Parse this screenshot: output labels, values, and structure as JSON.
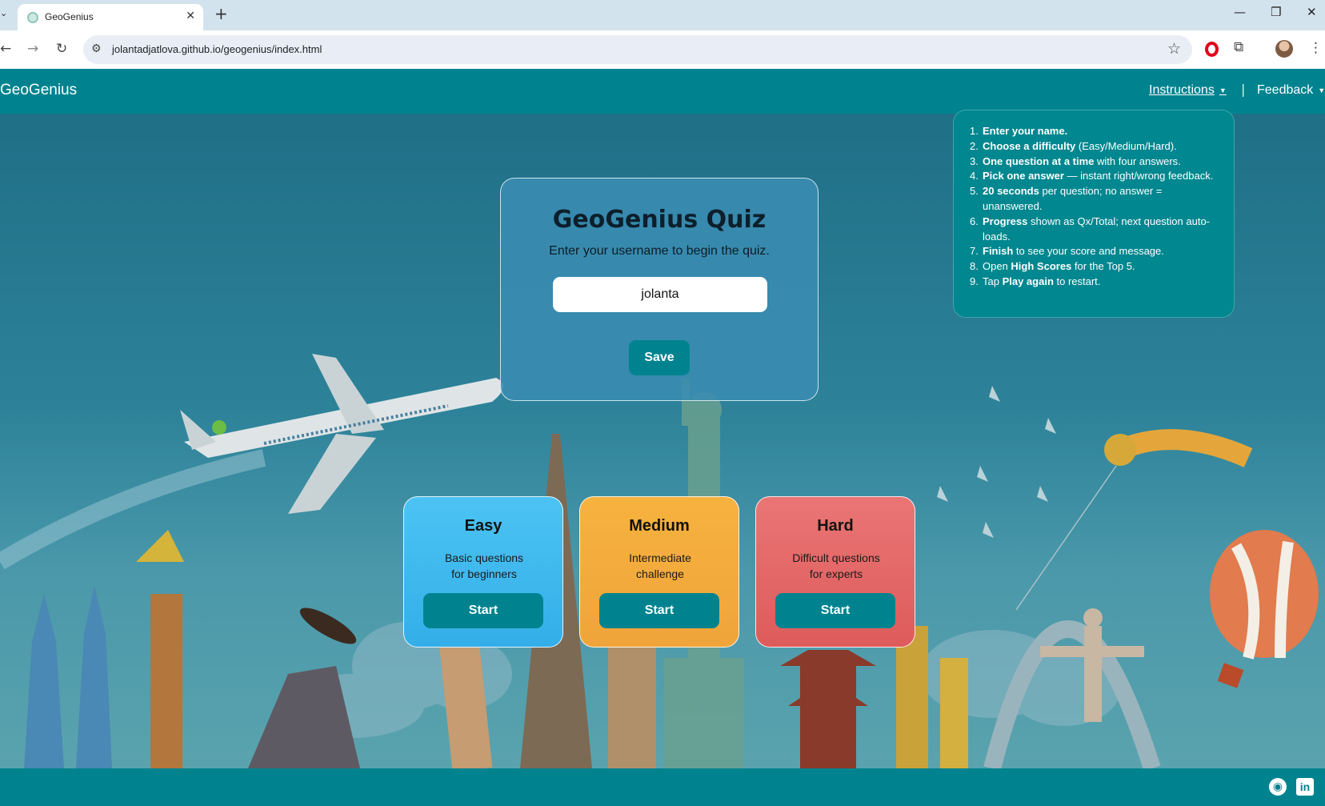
{
  "browser": {
    "tab_title": "GeoGenius",
    "url": "jolantadjatlova.github.io/geogenius/index.html"
  },
  "navbar": {
    "brand": "GeoGenius",
    "instructions_label": "Instructions",
    "separator": "|",
    "feedback_label": "Feedback"
  },
  "instructions": [
    {
      "num": "1.",
      "bold": "Enter your name.",
      "rest": ""
    },
    {
      "num": "2.",
      "bold": "Choose a difficulty",
      "rest": " (Easy/Medium/Hard)."
    },
    {
      "num": "3.",
      "bold": "One question at a time",
      "rest": " with four answers."
    },
    {
      "num": "4.",
      "bold": "Pick one answer",
      "rest": " — instant right/wrong feedback."
    },
    {
      "num": "5.",
      "bold": "20 seconds",
      "rest": " per question; no answer = unanswered."
    },
    {
      "num": "6.",
      "bold": "Progress",
      "rest": " shown as Qx/Total; next question auto-loads."
    },
    {
      "num": "7.",
      "bold": "Finish",
      "rest": " to see your score and message."
    },
    {
      "num": "8.",
      "pre": "Open ",
      "bold": "High Scores",
      "rest": " for the Top 5."
    },
    {
      "num": "9.",
      "pre": "Tap ",
      "bold": "Play again",
      "rest": " to restart."
    }
  ],
  "login": {
    "title": "GeoGenius Quiz",
    "subtitle": "Enter your username to begin the quiz.",
    "username_value": "jolanta",
    "save_label": "Save"
  },
  "difficulties": [
    {
      "title": "Easy",
      "line1": "Basic questions",
      "line2": "for beginners",
      "button": "Start"
    },
    {
      "title": "Medium",
      "line1": "Intermediate",
      "line2": "challenge",
      "button": "Start"
    },
    {
      "title": "Hard",
      "line1": "Difficult questions",
      "line2": "for experts",
      "button": "Start"
    }
  ],
  "colors": {
    "brand_teal": "#00838f",
    "easy": "#3fb8ee",
    "medium": "#f3aa3c",
    "hard": "#e36666"
  },
  "icons": {
    "footer": [
      "github-icon",
      "linkedin-icon"
    ]
  }
}
